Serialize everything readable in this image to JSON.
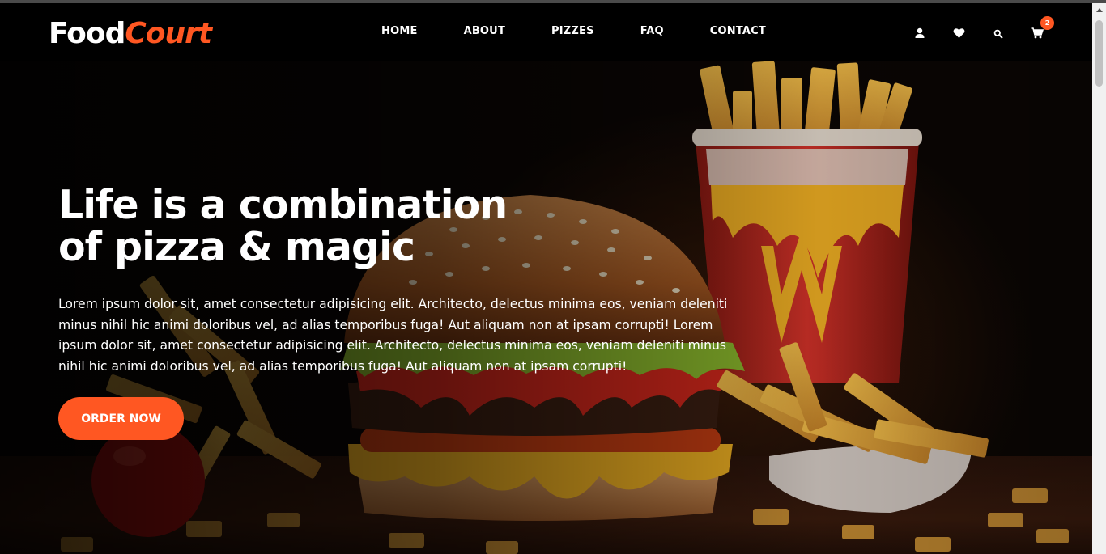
{
  "brand": {
    "part1": "Food",
    "part2": "Court"
  },
  "nav": {
    "items": [
      {
        "label": "HOME"
      },
      {
        "label": "ABOUT"
      },
      {
        "label": "PIZZES"
      },
      {
        "label": "FAQ"
      },
      {
        "label": "CONTACT"
      }
    ]
  },
  "header_icons": [
    "user-icon",
    "heart-icon",
    "search-icon",
    "cart-icon"
  ],
  "cart": {
    "count": "2"
  },
  "hero": {
    "title_line1": "Life is a combination",
    "title_line2": "of pizza & magic",
    "paragraph": "Lorem ipsum dolor sit, amet consectetur adipisicing elit. Architecto, delectus minima eos, veniam deleniti minus nihil hic animi doloribus vel, ad alias temporibus fuga! Aut aliquam non at ipsam corrupti! Lorem ipsum dolor sit, amet consectetur adipisicing elit. Architecto, delectus minima eos, veniam deleniti minus nihil hic animi doloribus vel, ad alias temporibus fuga! Aut aliquam non at ipsam corrupti!",
    "cta_label": "ORDER NOW"
  },
  "colors": {
    "accent": "#ff5722",
    "header_bg": "#000000",
    "text": "#ffffff"
  }
}
